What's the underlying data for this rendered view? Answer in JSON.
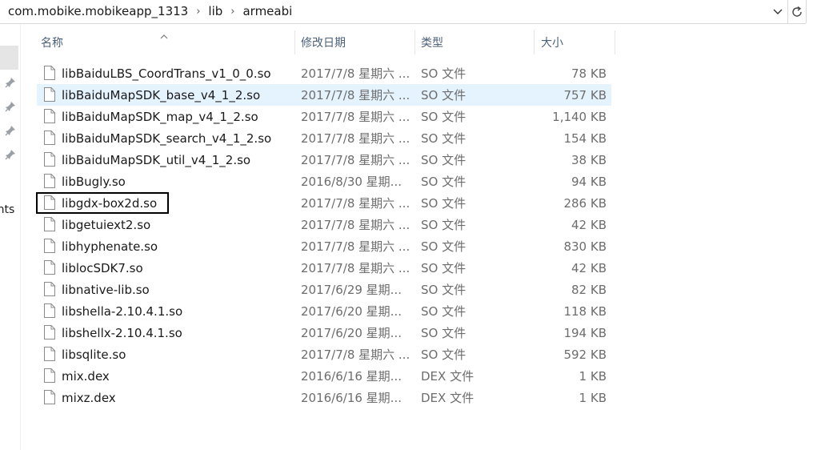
{
  "breadcrumb": [
    "com.mobike.mobikeapp_1313",
    "lib",
    "armeabi"
  ],
  "nav_partial_label": "ents",
  "columns": {
    "name": "名称",
    "date": "修改日期",
    "type": "类型",
    "size": "大小"
  },
  "files": [
    {
      "name": "libBaiduLBS_CoordTrans_v1_0_0.so",
      "date": "2017/7/8 星期六 ...",
      "type": "SO 文件",
      "size": "78 KB"
    },
    {
      "name": "libBaiduMapSDK_base_v4_1_2.so",
      "date": "2017/7/8 星期六 ...",
      "type": "SO 文件",
      "size": "757 KB"
    },
    {
      "name": "libBaiduMapSDK_map_v4_1_2.so",
      "date": "2017/7/8 星期六 ...",
      "type": "SO 文件",
      "size": "1,140 KB"
    },
    {
      "name": "libBaiduMapSDK_search_v4_1_2.so",
      "date": "2017/7/8 星期六 ...",
      "type": "SO 文件",
      "size": "154 KB"
    },
    {
      "name": "libBaiduMapSDK_util_v4_1_2.so",
      "date": "2017/7/8 星期六 ...",
      "type": "SO 文件",
      "size": "38 KB"
    },
    {
      "name": "libBugly.so",
      "date": "2016/8/30 星期...",
      "type": "SO 文件",
      "size": "94 KB"
    },
    {
      "name": "libgdx-box2d.so",
      "date": "2017/7/8 星期六 ...",
      "type": "SO 文件",
      "size": "286 KB"
    },
    {
      "name": "libgetuiext2.so",
      "date": "2017/7/8 星期六 ...",
      "type": "SO 文件",
      "size": "42 KB"
    },
    {
      "name": "libhyphenate.so",
      "date": "2017/7/8 星期六 ...",
      "type": "SO 文件",
      "size": "830 KB"
    },
    {
      "name": "liblocSDK7.so",
      "date": "2017/7/8 星期六 ...",
      "type": "SO 文件",
      "size": "42 KB"
    },
    {
      "name": "libnative-lib.so",
      "date": "2017/6/29 星期...",
      "type": "SO 文件",
      "size": "82 KB"
    },
    {
      "name": "libshella-2.10.4.1.so",
      "date": "2017/6/20 星期...",
      "type": "SO 文件",
      "size": "118 KB"
    },
    {
      "name": "libshellx-2.10.4.1.so",
      "date": "2017/6/20 星期...",
      "type": "SO 文件",
      "size": "194 KB"
    },
    {
      "name": "libsqlite.so",
      "date": "2017/7/8 星期六 ...",
      "type": "SO 文件",
      "size": "592 KB"
    },
    {
      "name": "mix.dex",
      "date": "2016/6/16 星期...",
      "type": "DEX 文件",
      "size": "1 KB"
    },
    {
      "name": "mixz.dex",
      "date": "2016/6/16 星期...",
      "type": "DEX 文件",
      "size": "1 KB"
    }
  ],
  "hovered_file": "libBaiduMapSDK_base_v4_1_2.so",
  "focused_file": "libgdx-box2d.so",
  "icons": {
    "address_dropdown": "chevron-down-icon",
    "refresh": "refresh-icon",
    "pin": "pin-icon",
    "file": "file-icon",
    "sort": "sort-up-icon"
  }
}
